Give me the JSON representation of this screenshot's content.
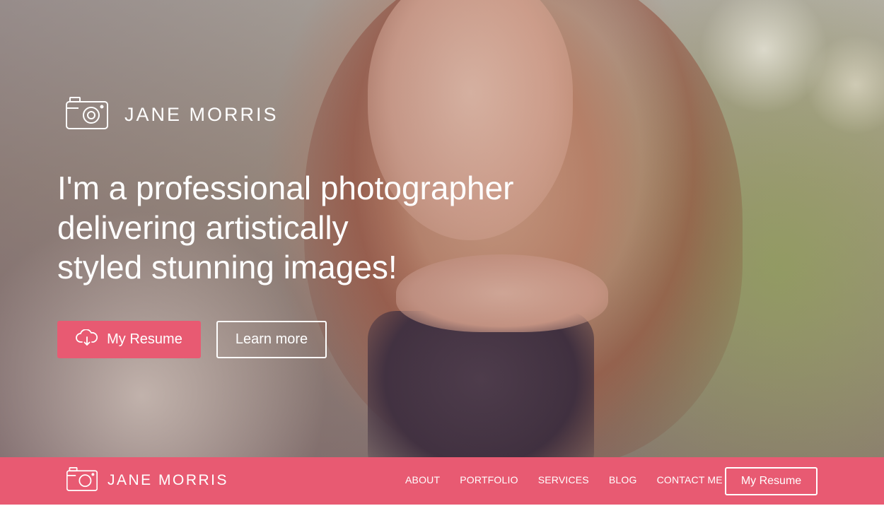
{
  "hero": {
    "brand": {
      "icon": "camera-icon",
      "name": "JANE MORRIS"
    },
    "headline_lines": [
      "I'm a professional photographer",
      "delivering artistically",
      "styled stunning images!"
    ],
    "primary_button": {
      "icon": "cloud-download-icon",
      "label": "My Resume"
    },
    "secondary_button": {
      "label": "Learn more"
    }
  },
  "navbar": {
    "brand": {
      "icon": "camera-icon",
      "name": "JANE MORRIS"
    },
    "links": [
      "ABOUT",
      "PORTFOLIO",
      "SERVICES",
      "BLOG",
      "CONTACT ME"
    ],
    "cta_label": "My Resume"
  },
  "colors": {
    "accent": "#e85a72",
    "text_light": "#ffffff"
  }
}
